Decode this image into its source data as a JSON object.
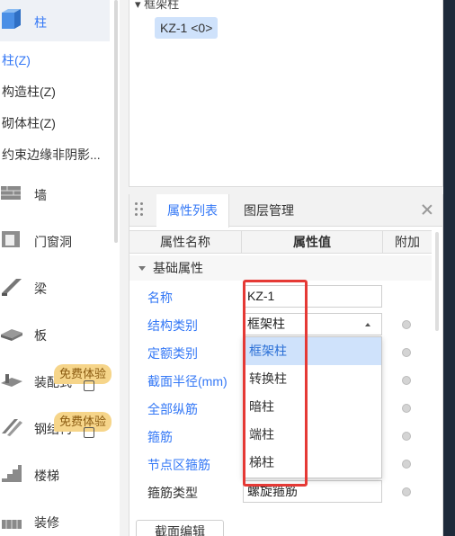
{
  "left_nav": {
    "items": [
      {
        "label": "柱",
        "icon": "column-icon",
        "active": true
      },
      {
        "label": "墙",
        "icon": "wall-icon"
      },
      {
        "label": "门窗洞",
        "icon": "door-window-icon"
      },
      {
        "label": "梁",
        "icon": "beam-icon"
      },
      {
        "label": "板",
        "icon": "slab-icon"
      },
      {
        "label": "装配式",
        "icon": "prefab-icon",
        "badge": "免费体验"
      },
      {
        "label": "钢结构",
        "icon": "steel-structure-icon",
        "badge": "免费体验"
      },
      {
        "label": "楼梯",
        "icon": "stair-icon"
      },
      {
        "label": "装修",
        "icon": "decoration-icon"
      }
    ],
    "sub_items": [
      "柱(Z)",
      "构造柱(Z)",
      "砌体柱(Z)",
      "约束边缘非阴影..."
    ]
  },
  "tree": {
    "root_label": "框架柱",
    "chip_label": "KZ-1 <0>"
  },
  "properties_panel": {
    "tabs": [
      "属性列表",
      "图层管理"
    ],
    "headers": [
      "属性名称",
      "属性值",
      "附加"
    ],
    "group_label": "基础属性",
    "rows": [
      {
        "name": "名称",
        "value": "KZ-1"
      },
      {
        "name": "结构类别",
        "value": "框架柱"
      },
      {
        "name": "定额类别",
        "value": ""
      },
      {
        "name": "截面半径(mm)",
        "value": ""
      },
      {
        "name": "全部纵筋",
        "value": ""
      },
      {
        "name": "箍筋",
        "value": ""
      },
      {
        "name": "节点区箍筋",
        "value": ""
      },
      {
        "name": "箍筋类型",
        "value": "螺旋箍筋"
      }
    ],
    "dropdown_options": [
      "框架柱",
      "转换柱",
      "暗柱",
      "端柱",
      "梯柱"
    ],
    "dropdown_selected": "框架柱",
    "edit_button": "截面编辑"
  },
  "colors": {
    "accent": "#3478f6",
    "selection": "#cfe2fb",
    "highlight_box": "#e53935",
    "badge": "#f6d58a"
  }
}
